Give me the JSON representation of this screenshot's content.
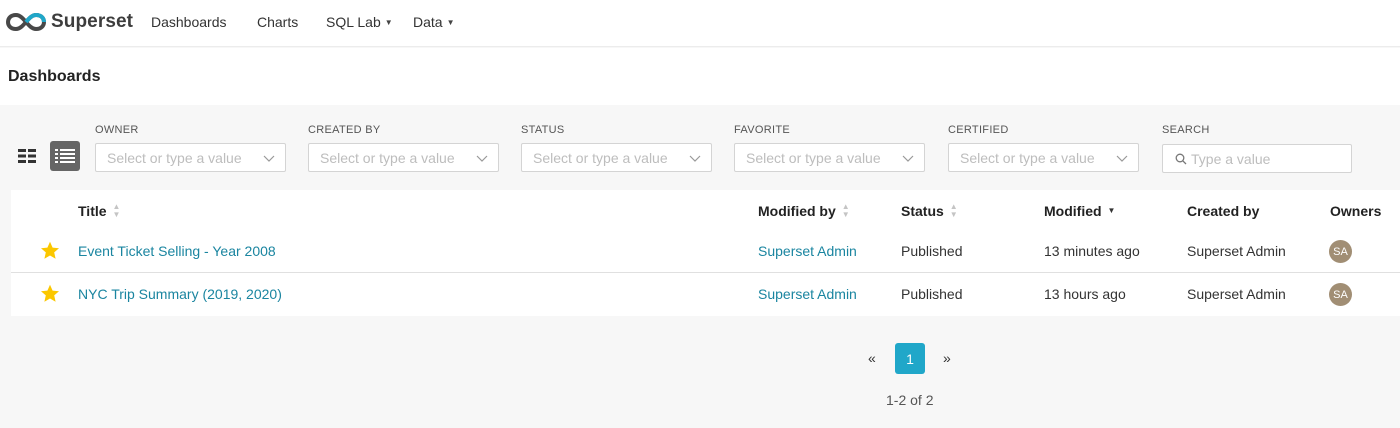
{
  "app": {
    "name": "Superset"
  },
  "nav": {
    "dashboards": "Dashboards",
    "charts": "Charts",
    "sql_lab": "SQL Lab",
    "data": "Data"
  },
  "page": {
    "title": "Dashboards"
  },
  "filters": {
    "owner": {
      "label": "OWNER",
      "placeholder": "Select or type a value"
    },
    "created_by": {
      "label": "CREATED BY",
      "placeholder": "Select or type a value"
    },
    "status": {
      "label": "STATUS",
      "placeholder": "Select or type a value"
    },
    "favorite": {
      "label": "FAVORITE",
      "placeholder": "Select or type a value"
    },
    "certified": {
      "label": "CERTIFIED",
      "placeholder": "Select or type a value"
    },
    "search": {
      "label": "SEARCH",
      "placeholder": "Type a value",
      "value": ""
    }
  },
  "table": {
    "columns": {
      "title": "Title",
      "modified_by": "Modified by",
      "status": "Status",
      "modified": "Modified",
      "created_by": "Created by",
      "owners": "Owners"
    },
    "sorted_by": "Modified",
    "rows": [
      {
        "favorite": true,
        "title": "Event Ticket Selling - Year 2008",
        "modified_by": "Superset Admin",
        "status": "Published",
        "modified": "13 minutes ago",
        "created_by": "Superset Admin",
        "owner_initials": "SA"
      },
      {
        "favorite": true,
        "title": "NYC Trip Summary (2019, 2020)",
        "modified_by": "Superset Admin",
        "status": "Published",
        "modified": "13 hours ago",
        "created_by": "Superset Admin",
        "owner_initials": "SA"
      }
    ]
  },
  "pagination": {
    "prev": "«",
    "next": "»",
    "current_page": "1",
    "range_text": "1-2 of 2"
  },
  "colors": {
    "link": "#1a85a0",
    "primary": "#20a7c9",
    "star": "#fbc700",
    "avatar": "#a18e74"
  }
}
